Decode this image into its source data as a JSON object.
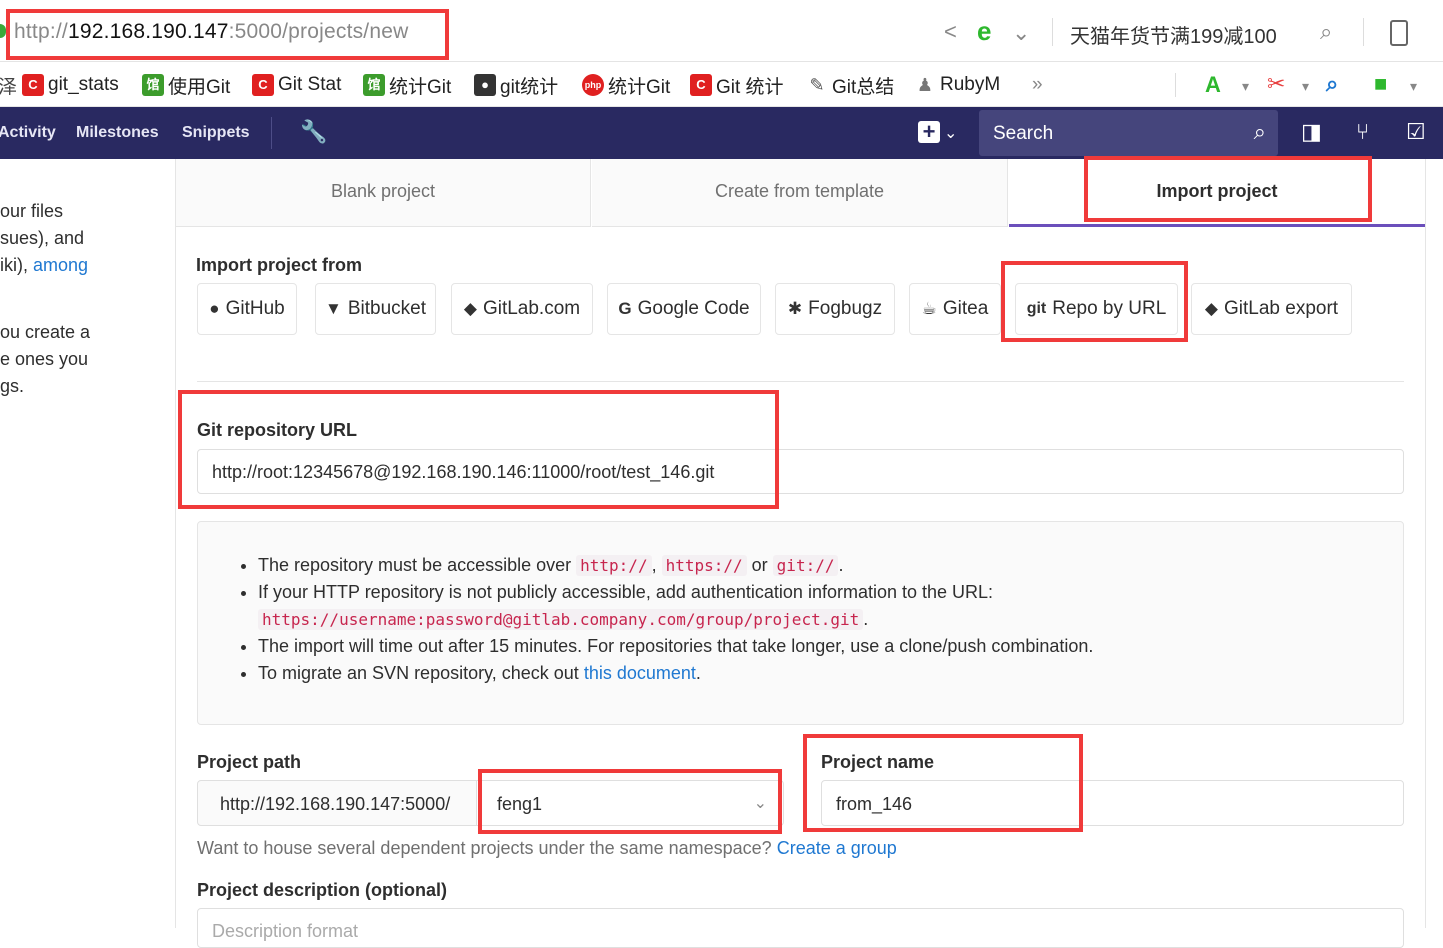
{
  "browser": {
    "url_scheme": "http://",
    "url_host": "192.168.190.147",
    "url_rest": ":5000/projects/new",
    "promo_text": "天猫年货节满199减100"
  },
  "bookmarks": [
    {
      "label": "git_stats",
      "icon": "C",
      "color": "#e02020"
    },
    {
      "label": "使用Git",
      "icon": "馆",
      "color": "#3c9c2c"
    },
    {
      "label": "Git Stat",
      "icon": "C",
      "color": "#e02020"
    },
    {
      "label": "统计Git",
      "icon": "馆",
      "color": "#3c9c2c"
    },
    {
      "label": "git统计",
      "icon": "●",
      "color": "#333333"
    },
    {
      "label": "统计Git",
      "icon": "php",
      "color": "#e02020"
    },
    {
      "label": "Git 统计",
      "icon": "C",
      "color": "#e02020"
    },
    {
      "label": "Git总结",
      "icon": "✎",
      "color": "#555555"
    },
    {
      "label": "RubyM",
      "icon": "♟",
      "color": "#777777"
    }
  ],
  "nav": {
    "activity": "Activity",
    "milestones": "Milestones",
    "snippets": "Snippets",
    "search_placeholder": "Search"
  },
  "left_description": {
    "line1": "our files",
    "line2": "sues), and",
    "line3_prefix": "iki), ",
    "line3_link": "among",
    "line4": "ou create a",
    "line5": "e ones you",
    "line6": "gs."
  },
  "tabs": {
    "blank": "Blank project",
    "template": "Create from template",
    "import": "Import project"
  },
  "import_from": {
    "heading": "Import project from",
    "sources": [
      {
        "label": "GitHub",
        "icon": "github-icon"
      },
      {
        "label": "Bitbucket",
        "icon": "bitbucket-icon"
      },
      {
        "label": "GitLab.com",
        "icon": "gitlab-icon"
      },
      {
        "label": "Google Code",
        "icon": "google-icon"
      },
      {
        "label": "Fogbugz",
        "icon": "bug-icon"
      },
      {
        "label": "Gitea",
        "icon": "gitea-icon"
      },
      {
        "label": "Repo by URL",
        "icon": "git-icon"
      },
      {
        "label": "GitLab export",
        "icon": "gitlab-icon"
      }
    ]
  },
  "repo_url": {
    "label": "Git repository URL",
    "value": "http://root:12345678@192.168.190.146:11000/root/test_146.git"
  },
  "help": {
    "item1_text": "The repository must be accessible over ",
    "item1_code1": "http://",
    "item1_code2": "https://",
    "item1_or": " or ",
    "item1_code3": "git://",
    "item2_text": "If your HTTP repository is not publicly accessible, add authentication information to the URL:",
    "item2_code": "https://username:password@gitlab.company.com/group/project.git",
    "item3_text": "The import will time out after 15 minutes. For repositories that take longer, use a clone/push combination.",
    "item4_text": "To migrate an SVN repository, check out ",
    "item4_link": "this document"
  },
  "project_path": {
    "label": "Project path",
    "prefix": "http://192.168.190.147:5000/",
    "namespace": "feng1"
  },
  "project_name": {
    "label": "Project name",
    "value": "from_146"
  },
  "group_hint": {
    "text": "Want to house several dependent projects under the same namespace? ",
    "link": "Create a group"
  },
  "description": {
    "label": "Project description (optional)",
    "placeholder": "Description format"
  }
}
